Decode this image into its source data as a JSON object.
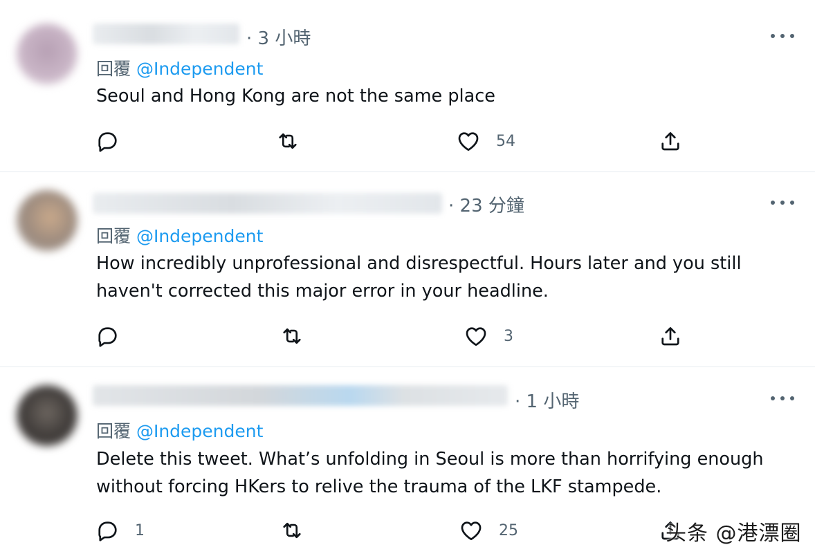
{
  "replies": [
    {
      "time": "· 3 小時",
      "reply_prefix": "回覆",
      "reply_handle": "@Independent",
      "text_lines": [
        "Seoul and Hong Kong are not the same place"
      ],
      "reply_count": "",
      "retweet_count": "",
      "like_count": "54"
    },
    {
      "time": "· 23 分鐘",
      "reply_prefix": "回覆",
      "reply_handle": "@Independent",
      "text_lines": [
        "How incredibly unprofessional and disrespectful. Hours later and you still",
        "haven't corrected this major error in your headline."
      ],
      "reply_count": "",
      "retweet_count": "",
      "like_count": "3"
    },
    {
      "time": "· 1 小時",
      "reply_prefix": "回覆",
      "reply_handle": "@Independent",
      "text_lines": [
        "Delete this tweet. What’s unfolding in Seoul is more than horrifying enough",
        "without forcing HKers to relive the trauma of the LKF stampede."
      ],
      "reply_count": "1",
      "retweet_count": "",
      "like_count": "25"
    }
  ],
  "watermark": "头条 @港漂圈",
  "colors": {
    "accent": "#1d9bf0",
    "secondary_text": "#536471",
    "primary_text": "#0f1419"
  }
}
